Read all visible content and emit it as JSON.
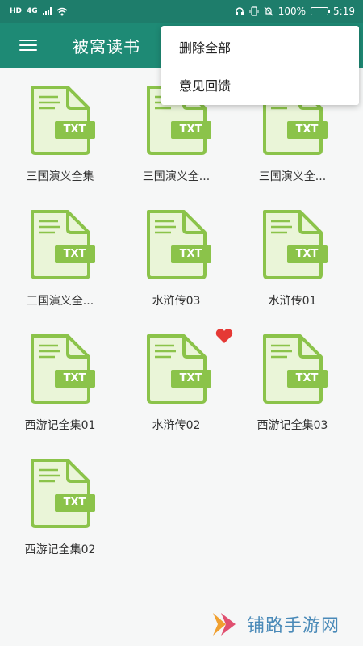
{
  "status_bar": {
    "hd": "HD",
    "network": "4G",
    "battery_percent": "100%",
    "time": "5:19"
  },
  "app_bar": {
    "title": "被窝读书"
  },
  "menu": {
    "items": [
      {
        "label": "删除全部"
      },
      {
        "label": "意见回馈"
      }
    ]
  },
  "files": [
    {
      "name": "三国演义全集",
      "ext": "TXT",
      "favorite": false
    },
    {
      "name": "三国演义全...",
      "ext": "TXT",
      "favorite": false
    },
    {
      "name": "三国演义全...",
      "ext": "TXT",
      "favorite": false
    },
    {
      "name": "三国演义全...",
      "ext": "TXT",
      "favorite": false
    },
    {
      "name": "水浒传03",
      "ext": "TXT",
      "favorite": false
    },
    {
      "name": "水浒传01",
      "ext": "TXT",
      "favorite": false
    },
    {
      "name": "西游记全集01",
      "ext": "TXT",
      "favorite": false
    },
    {
      "name": "水浒传02",
      "ext": "TXT",
      "favorite": true
    },
    {
      "name": "西游记全集03",
      "ext": "TXT",
      "favorite": false
    },
    {
      "name": "西游记全集02",
      "ext": "TXT",
      "favorite": false
    }
  ],
  "watermark": {
    "text": "铺路手游网"
  },
  "colors": {
    "header": "#1e8a75",
    "status_bar": "#1e7d6b",
    "file_icon_green": "#8bc34a",
    "file_icon_fill": "#eaf5d8",
    "heart": "#e53935"
  }
}
